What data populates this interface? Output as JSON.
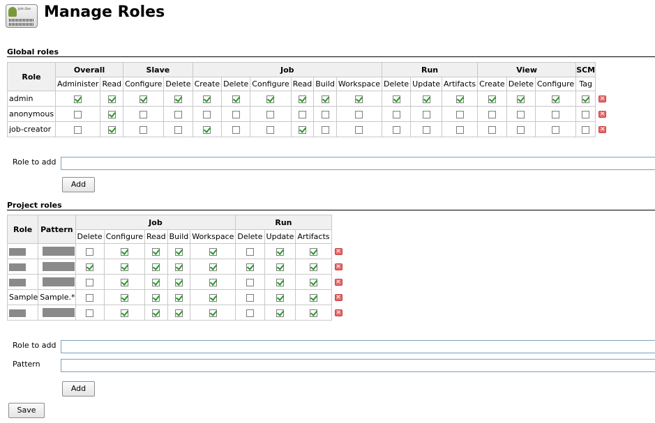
{
  "header": {
    "title": "Manage Roles",
    "avatar_name": "John Doe"
  },
  "global": {
    "heading": "Global roles",
    "role_header": "Role",
    "groups": [
      {
        "label": "Overall",
        "span": 2
      },
      {
        "label": "Slave",
        "span": 2
      },
      {
        "label": "Job",
        "span": 6
      },
      {
        "label": "Run",
        "span": 3
      },
      {
        "label": "View",
        "span": 3
      },
      {
        "label": "SCM",
        "span": 1
      }
    ],
    "permissions": [
      "Administer",
      "Read",
      "Configure",
      "Delete",
      "Create",
      "Delete",
      "Configure",
      "Read",
      "Build",
      "Workspace",
      "Delete",
      "Update",
      "Artifacts",
      "Create",
      "Delete",
      "Configure",
      "Tag"
    ],
    "rows": [
      {
        "role": "admin",
        "checks": [
          1,
          1,
          1,
          1,
          1,
          1,
          1,
          1,
          1,
          1,
          1,
          1,
          1,
          1,
          1,
          1,
          1
        ]
      },
      {
        "role": "anonymous",
        "checks": [
          0,
          1,
          0,
          0,
          0,
          0,
          0,
          0,
          0,
          0,
          0,
          0,
          0,
          0,
          0,
          0,
          0
        ]
      },
      {
        "role": "job-creator",
        "checks": [
          0,
          1,
          0,
          0,
          1,
          0,
          0,
          1,
          0,
          0,
          0,
          0,
          0,
          0,
          0,
          0,
          0
        ]
      }
    ],
    "role_to_add_label": "Role to add",
    "role_to_add_value": "",
    "add_button": "Add"
  },
  "project": {
    "heading": "Project roles",
    "role_header": "Role",
    "pattern_header": "Pattern",
    "groups": [
      {
        "label": "Job",
        "span": 5
      },
      {
        "label": "Run",
        "span": 3
      }
    ],
    "permissions": [
      "Delete",
      "Configure",
      "Read",
      "Build",
      "Workspace",
      "Delete",
      "Update",
      "Artifacts"
    ],
    "rows": [
      {
        "role": "",
        "pattern": "",
        "redacted": true,
        "checks": [
          0,
          1,
          1,
          1,
          1,
          0,
          1,
          1
        ]
      },
      {
        "role": "",
        "pattern": "",
        "redacted": true,
        "checks": [
          1,
          1,
          1,
          1,
          1,
          1,
          1,
          1
        ]
      },
      {
        "role": "",
        "pattern": "",
        "redacted": true,
        "checks": [
          0,
          1,
          1,
          1,
          1,
          0,
          1,
          1
        ]
      },
      {
        "role": "Sample",
        "pattern": "Sample.*",
        "redacted": false,
        "checks": [
          0,
          1,
          1,
          1,
          1,
          0,
          1,
          1
        ]
      },
      {
        "role": "",
        "pattern": "",
        "redacted": true,
        "checks": [
          0,
          1,
          1,
          1,
          1,
          0,
          1,
          1
        ]
      }
    ],
    "role_to_add_label": "Role to add",
    "role_to_add_value": "",
    "pattern_label": "Pattern",
    "pattern_value": "",
    "add_button": "Add"
  },
  "save_button": "Save"
}
